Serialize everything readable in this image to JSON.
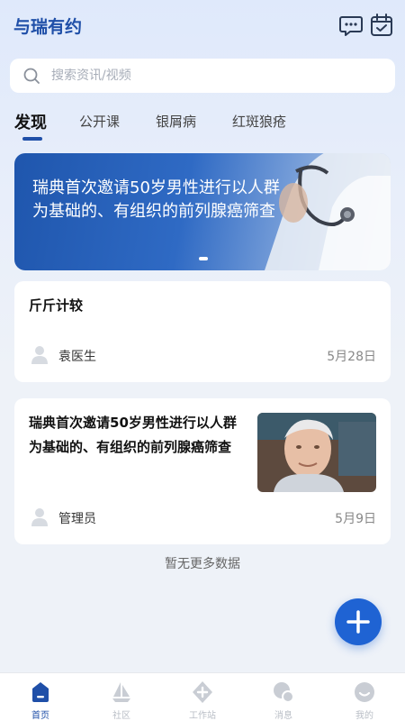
{
  "header": {
    "title": "与瑞有约",
    "icons": [
      "message-icon",
      "calendar-check-icon"
    ]
  },
  "search": {
    "placeholder": "搜索资讯/视频"
  },
  "tabs": [
    {
      "label": "发现",
      "active": true
    },
    {
      "label": "公开课",
      "active": false
    },
    {
      "label": "银屑病",
      "active": false
    },
    {
      "label": "红斑狼疮",
      "active": false
    }
  ],
  "banner": {
    "text": "瑞典首次邀请50岁男性进行以人群为基础的、有组织的前列腺癌筛查"
  },
  "articles": [
    {
      "title": "斤斤计较",
      "author": "袁医生",
      "date": "5月28日"
    },
    {
      "title": "瑞典首次邀请50岁男性进行以人群为基础的、有组织的前列腺癌筛查",
      "author": "管理员",
      "date": "5月9日"
    }
  ],
  "footer_text": "暂无更多数据",
  "tabbar": [
    {
      "label": "首页",
      "icon": "home-icon",
      "active": true
    },
    {
      "label": "社区",
      "icon": "sailboat-icon",
      "active": false
    },
    {
      "label": "工作站",
      "icon": "workstation-icon",
      "active": false
    },
    {
      "label": "消息",
      "icon": "message-bubble-icon",
      "active": false
    },
    {
      "label": "我的",
      "icon": "profile-icon",
      "active": false
    }
  ],
  "colors": {
    "brand": "#1f4fa8",
    "fab": "#1f63d3",
    "inactive": "#b9bec6"
  }
}
